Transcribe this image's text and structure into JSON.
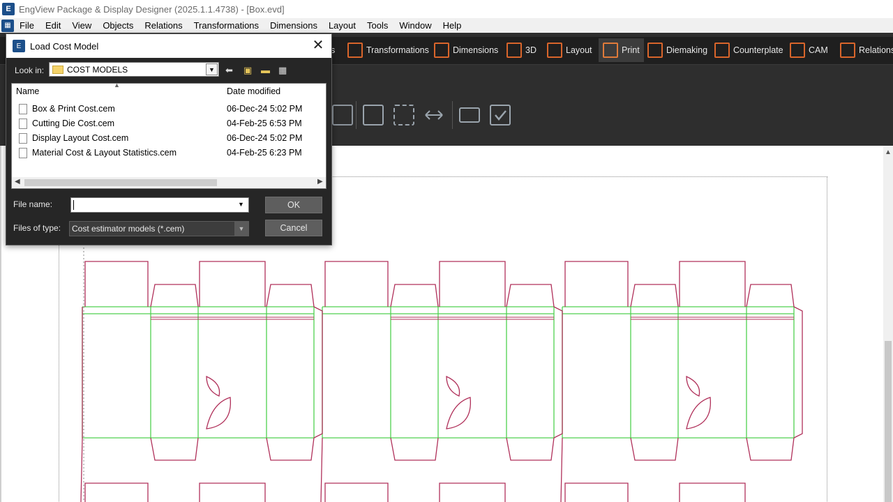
{
  "window": {
    "title": "EngView Package & Display Designer (2025.1.1.4738) - [Box.evd]"
  },
  "menu": [
    "File",
    "Edit",
    "View",
    "Objects",
    "Relations",
    "Transformations",
    "Dimensions",
    "Layout",
    "Tools",
    "Window",
    "Help"
  ],
  "ribbon": {
    "partial_tab": "s",
    "tabs": [
      "Transformations",
      "Dimensions",
      "3D",
      "Layout",
      "Print",
      "Diemaking",
      "Counterplate",
      "CAM",
      "Relations"
    ],
    "active_tab": "Print"
  },
  "dialog": {
    "title": "Load Cost Model",
    "look_in_label": "Look in:",
    "look_in_value": "COST MODELS",
    "columns": {
      "name": "Name",
      "date": "Date modified"
    },
    "files": [
      {
        "name": "Box & Print Cost.cem",
        "date": "06-Dec-24 5:02 PM"
      },
      {
        "name": "Cutting Die Cost.cem",
        "date": "04-Feb-25 6:53 PM"
      },
      {
        "name": "Display Layout Cost.cem",
        "date": "06-Dec-24 5:02 PM"
      },
      {
        "name": "Material Cost & Layout Statistics.cem",
        "date": "04-Feb-25 6:23 PM"
      }
    ],
    "file_name_label": "File name:",
    "file_name_value": "",
    "files_of_type_label": "Files of type:",
    "files_of_type_value": "Cost estimator models (*.cem)",
    "ok_label": "OK",
    "cancel_label": "Cancel"
  },
  "colors": {
    "cut_line": "#b0305a",
    "crease_line": "#4fd14f",
    "ribbon_bg": "#2e2e2e",
    "accent": "#e07b3a"
  }
}
